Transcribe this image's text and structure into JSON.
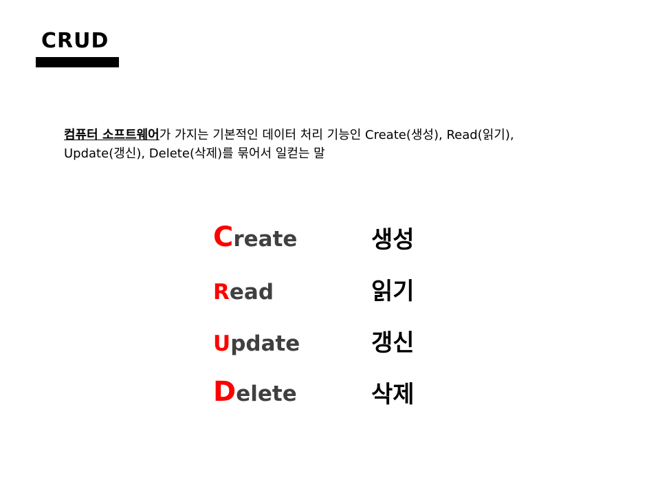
{
  "slide": {
    "title": "CRUD",
    "description": {
      "term": "컴퓨터 소프트웨어",
      "rest": "가 가지는 기본적인 데이터 처리 기능인 Create(생성), Read(읽기), Update(갱신), Delete(삭제)를 묶어서 일컫는 말"
    },
    "rows": [
      {
        "initial": "C",
        "rest": "reate",
        "korean": "생성"
      },
      {
        "initial": "R",
        "rest": "ead",
        "korean": "읽기"
      },
      {
        "initial": "U",
        "rest": "pdate",
        "korean": "갱신"
      },
      {
        "initial": "D",
        "rest": "elete",
        "korean": "삭제"
      }
    ]
  },
  "colors": {
    "accent": "#ff0000",
    "word_rest": "#404040",
    "text": "#000000",
    "background": "#ffffff"
  }
}
